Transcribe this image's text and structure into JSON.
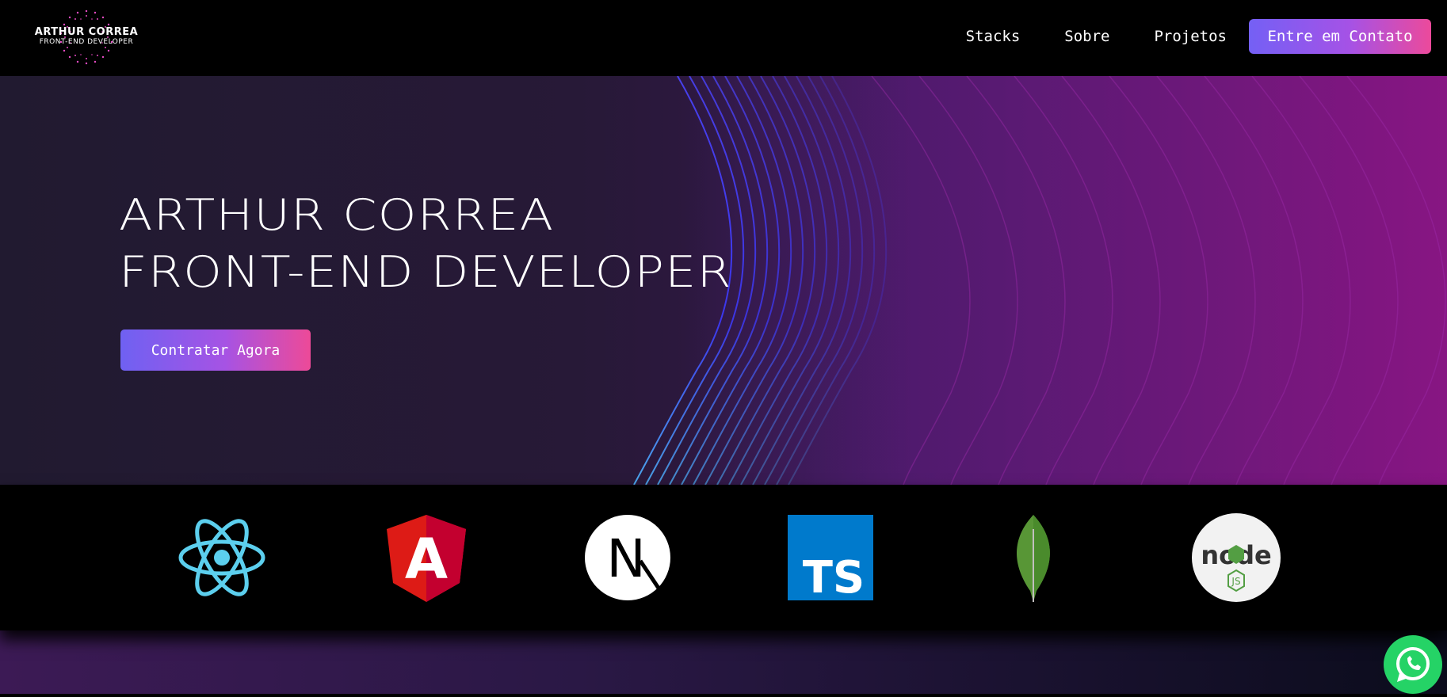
{
  "brand": {
    "name": "ARTHUR CORREA",
    "role": "FRONT-END DEVELOPER"
  },
  "nav": {
    "links": [
      "Stacks",
      "Sobre",
      "Projetos"
    ],
    "cta": "Entre em Contato"
  },
  "hero": {
    "line1": "ARTHUR CORREA",
    "line2": "FRONT-END DEVELOPER",
    "button": "Contratar Agora"
  },
  "stacks": {
    "icons": [
      "react-icon",
      "angular-icon",
      "nextjs-icon",
      "typescript-icon",
      "mongodb-icon",
      "nodejs-icon"
    ],
    "ts_text": "TS",
    "next_text": "N",
    "angular_text": "A",
    "node_text": "node",
    "node_js_text": "JS"
  },
  "whatsapp": {
    "icon": "whatsapp-icon"
  },
  "colors": {
    "accent_start": "#7460f5",
    "accent_mid": "#a552e6",
    "accent_end": "#ec4a9b",
    "react": "#5ccfee",
    "angular": "#dd1b16",
    "typescript": "#007acc",
    "mongodb": "#589636",
    "node": "#539e43",
    "whatsapp": "#25d366"
  }
}
